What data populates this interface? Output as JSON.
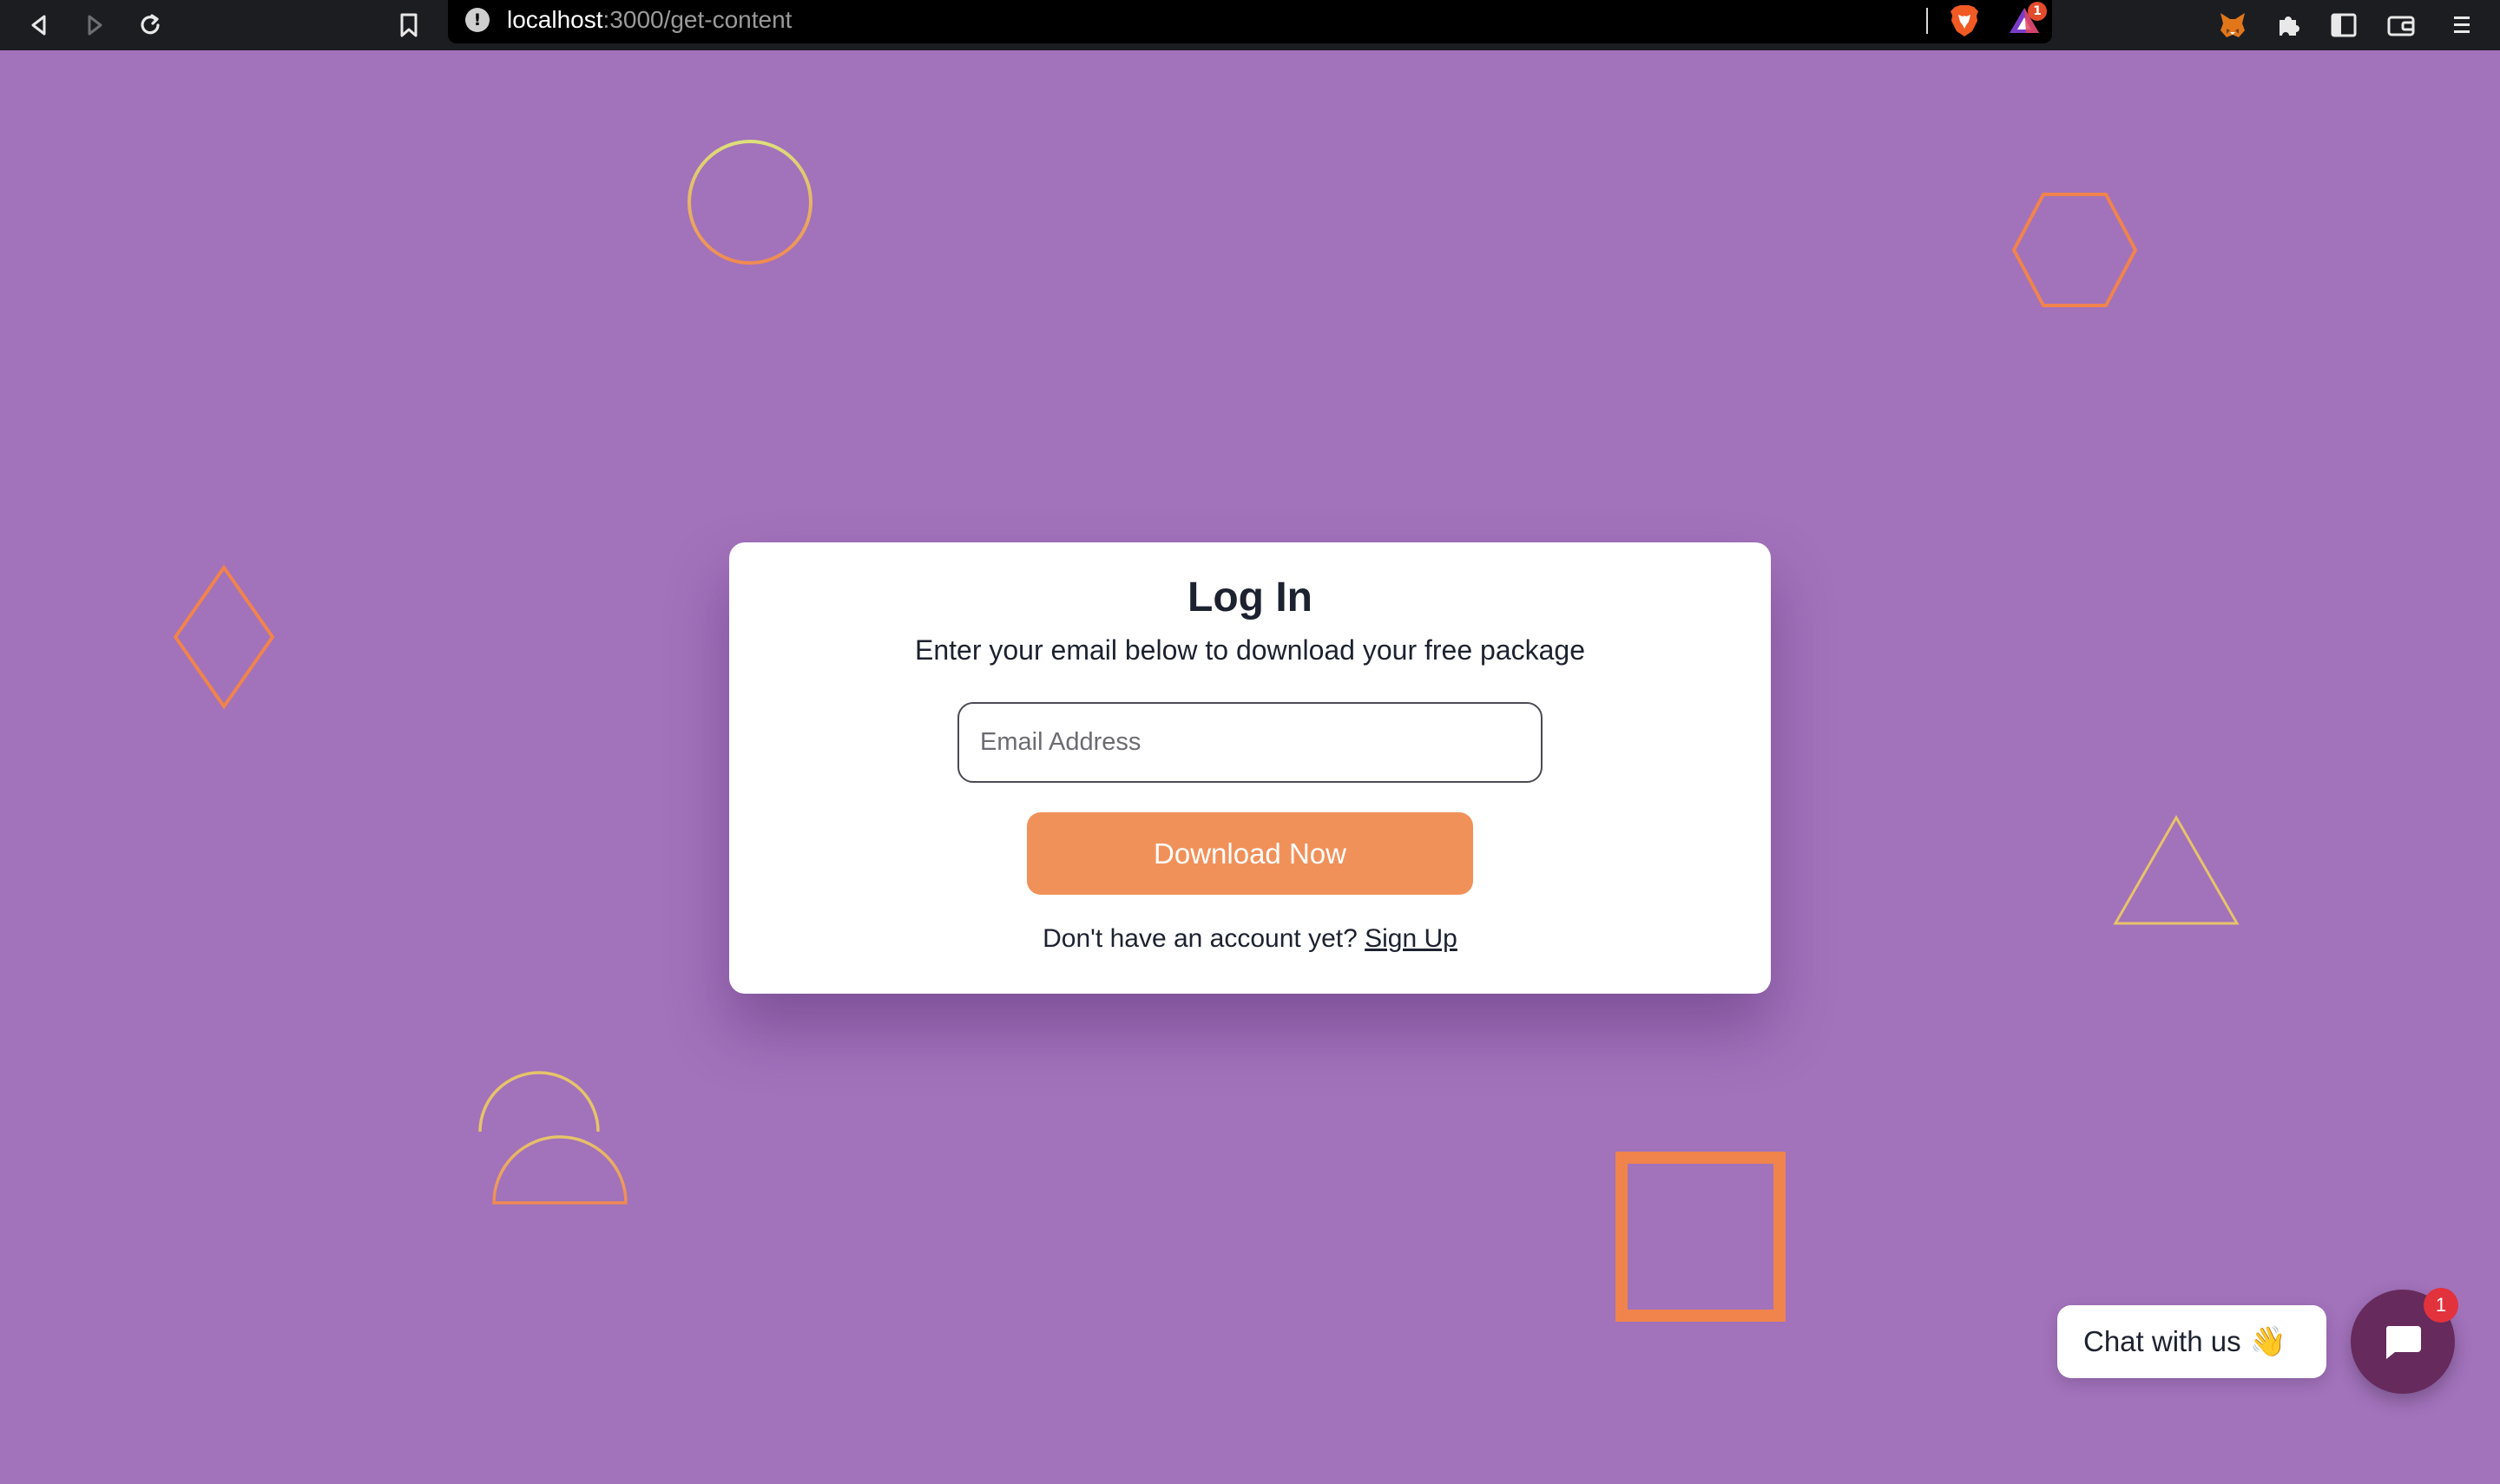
{
  "browser": {
    "url_host": "localhost",
    "url_path": ":3000/get-content",
    "rewards_badge": "1",
    "icons": [
      "back-icon",
      "forward-icon",
      "reload-icon",
      "bookmark-icon",
      "site-info-icon",
      "brave-shields-icon",
      "brave-rewards-icon",
      "metamask-fox-icon",
      "extensions-icon",
      "sidebar-icon",
      "wallet-icon",
      "menu-icon"
    ]
  },
  "login": {
    "title": "Log In",
    "subtitle": "Enter your email below to download your free package",
    "email_placeholder": "Email Address",
    "email_value": "",
    "download_label": "Download Now",
    "no_account_text": "Don't have an account yet?",
    "signup_label": "Sign Up"
  },
  "chat": {
    "label": "Chat with us",
    "emoji": "👋",
    "badge": "1"
  },
  "colors": {
    "background": "#a272bb",
    "accent": "#f1915a",
    "shape_orange": "#f0844c",
    "shape_yellow": "#e6c46a",
    "chat_button": "#662a5c"
  }
}
